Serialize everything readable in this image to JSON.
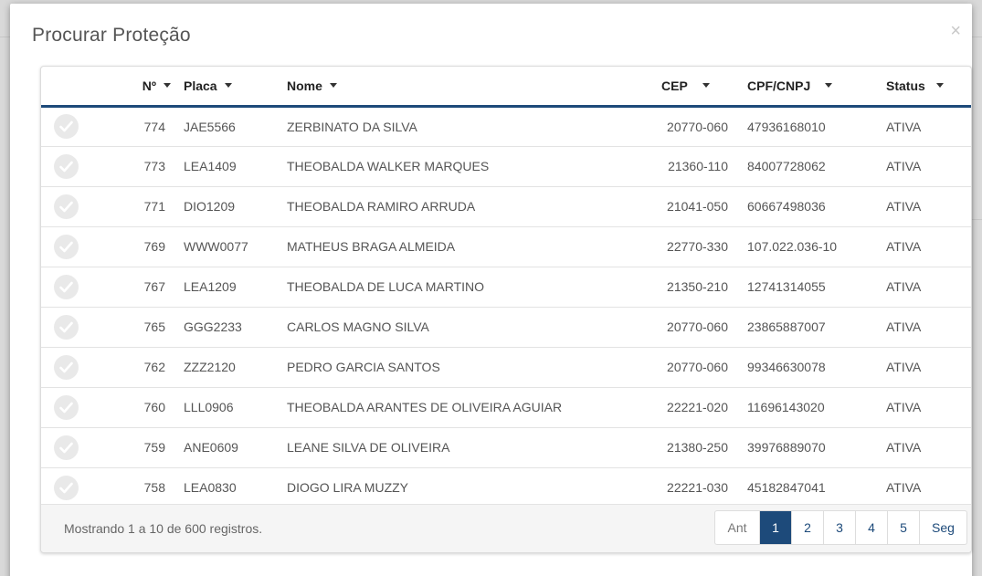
{
  "modal": {
    "title": "Procurar Proteção",
    "close_symbol": "×"
  },
  "table": {
    "columns": [
      "Nº",
      "Placa",
      "Nome",
      "CEP",
      "CPF/CNPJ",
      "Status"
    ],
    "rows": [
      {
        "num": "774",
        "plate": "JAE5566",
        "name": "ZERBINATO DA SILVA",
        "cep": "20770-060",
        "doc": "47936168010",
        "status": "ATIVA"
      },
      {
        "num": "773",
        "plate": "LEA1409",
        "name": "THEOBALDA WALKER MARQUES",
        "cep": "21360-110",
        "doc": "84007728062",
        "status": "ATIVA"
      },
      {
        "num": "771",
        "plate": "DIO1209",
        "name": "THEOBALDA RAMIRO ARRUDA",
        "cep": "21041-050",
        "doc": "60667498036",
        "status": "ATIVA"
      },
      {
        "num": "769",
        "plate": "WWW0077",
        "name": "MATHEUS BRAGA ALMEIDA",
        "cep": "22770-330",
        "doc": "107.022.036-10",
        "status": "ATIVA"
      },
      {
        "num": "767",
        "plate": "LEA1209",
        "name": "THEOBALDA DE LUCA MARTINO",
        "cep": "21350-210",
        "doc": "12741314055",
        "status": "ATIVA"
      },
      {
        "num": "765",
        "plate": "GGG2233",
        "name": "CARLOS MAGNO SILVA",
        "cep": "20770-060",
        "doc": "23865887007",
        "status": "ATIVA"
      },
      {
        "num": "762",
        "plate": "ZZZ2120",
        "name": "PEDRO GARCIA SANTOS",
        "cep": "20770-060",
        "doc": "99346630078",
        "status": "ATIVA"
      },
      {
        "num": "760",
        "plate": "LLL0906",
        "name": "THEOBALDA ARANTES DE OLIVEIRA AGUIAR",
        "cep": "22221-020",
        "doc": "11696143020",
        "status": "ATIVA"
      },
      {
        "num": "759",
        "plate": "ANE0609",
        "name": "LEANE SILVA DE OLIVEIRA",
        "cep": "21380-250",
        "doc": "39976889070",
        "status": "ATIVA"
      },
      {
        "num": "758",
        "plate": "LEA0830",
        "name": "DIOGO LIRA MUZZY",
        "cep": "22221-030",
        "doc": "45182847041",
        "status": "ATIVA"
      }
    ]
  },
  "footer": {
    "records_info": "Mostrando 1 a 10 de 600 registros.",
    "pagination": {
      "prev": "Ant",
      "pages": [
        "1",
        "2",
        "3",
        "4",
        "5"
      ],
      "active_page": "1",
      "next": "Seg"
    }
  },
  "icons": {
    "row_select": "check-circle-icon",
    "sort": "caret-down-icon",
    "pointer": "arrow-right-icon",
    "close": "close-icon"
  },
  "colors": {
    "accent": "#1d4a7a",
    "pointer_arrow": "#cc0000",
    "check_bg": "#e9e9e9"
  }
}
